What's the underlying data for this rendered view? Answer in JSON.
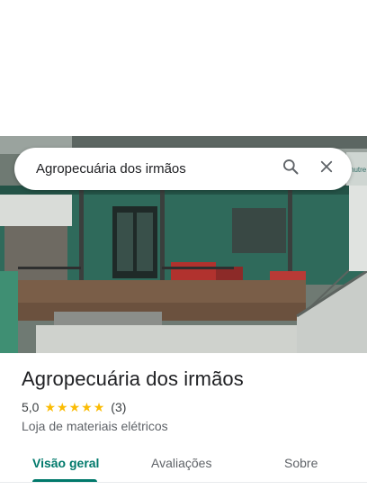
{
  "search": {
    "query": "Agropecuária dos irmãos",
    "search_icon": "search-icon",
    "close_icon": "close-icon"
  },
  "photo": {
    "sign_text": "nutre"
  },
  "place": {
    "name": "Agropecuária dos irmãos",
    "rating_value": "5,0",
    "stars": "★★★★★",
    "review_count": "(3)",
    "category": "Loja de materiais elétricos"
  },
  "tabs": [
    {
      "label": "Visão geral",
      "active": true
    },
    {
      "label": "Avaliações",
      "active": false
    },
    {
      "label": "Sobre",
      "active": false
    }
  ],
  "colors": {
    "accent": "#00796b",
    "star": "#fbbc04"
  }
}
